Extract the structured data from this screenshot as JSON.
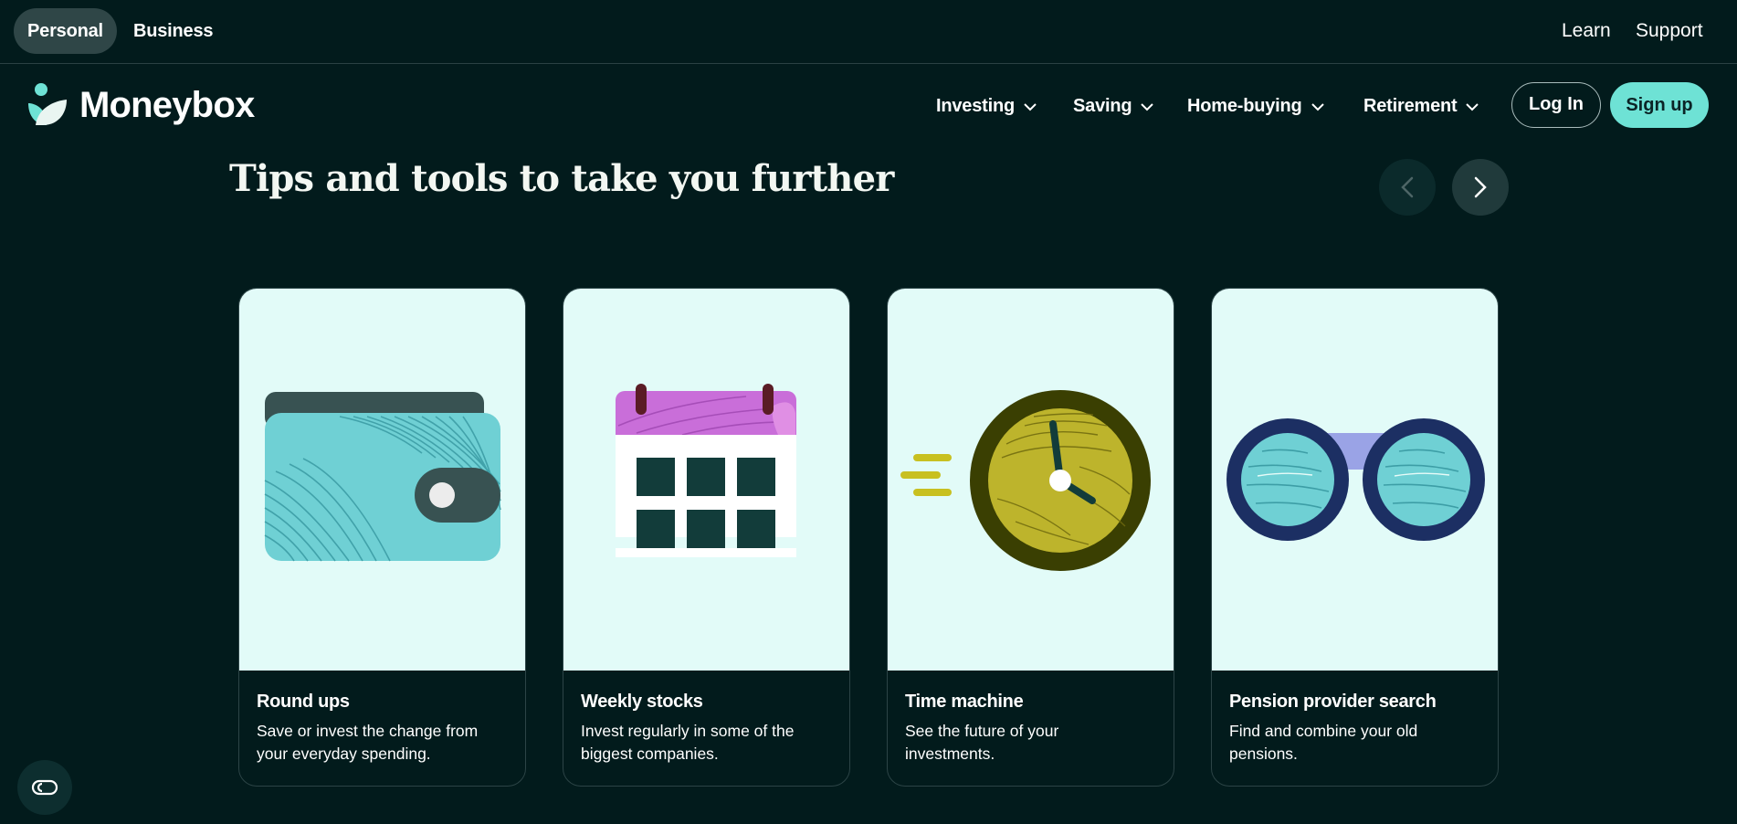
{
  "topbar": {
    "tabs": [
      {
        "label": "Personal",
        "active": true
      },
      {
        "label": "Business",
        "active": false
      }
    ],
    "links": [
      "Learn",
      "Support"
    ]
  },
  "nav": {
    "brand": "Moneybox",
    "items": [
      "Investing",
      "Saving",
      "Home-buying",
      "Retirement"
    ],
    "login_label": "Log In",
    "signup_label": "Sign up"
  },
  "section": {
    "title": "Tips and tools to take you further",
    "prev_icon": "chevron-left-icon",
    "next_icon": "chevron-right-icon"
  },
  "cards": [
    {
      "title": "Round ups",
      "description": "Save or invest the change from your everyday spending.",
      "icon": "wallet-icon"
    },
    {
      "title": "Weekly stocks",
      "description": "Invest regularly in some of the biggest companies.",
      "icon": "calendar-icon"
    },
    {
      "title": "Time machine",
      "description": "See the future of your investments.",
      "icon": "clock-icon"
    },
    {
      "title": "Pension provider search",
      "description": "Find and combine your old pensions.",
      "icon": "binoculars-icon"
    }
  ],
  "chat": {
    "icon": "chat-icon"
  },
  "colors": {
    "background": "#021b1c",
    "accent": "#6ee2d5",
    "card_art_bg": "#e2fbf8"
  }
}
